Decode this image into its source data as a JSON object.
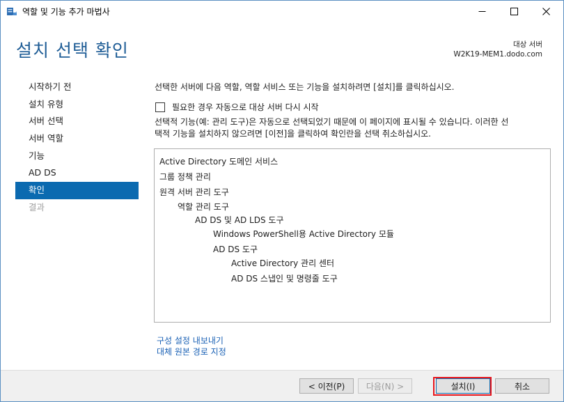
{
  "window": {
    "title": "역할 및 기능 추가 마법사",
    "minimize_glyph": "—",
    "maximize_glyph": "☐",
    "close_glyph": "✕"
  },
  "header": {
    "page_title": "설치 선택 확인",
    "dest_label": "대상 서버",
    "dest_server": "W2K19-MEM1.dodo.com"
  },
  "nav": {
    "items": [
      {
        "label": "시작하기 전",
        "state": "normal"
      },
      {
        "label": "설치 유형",
        "state": "normal"
      },
      {
        "label": "서버 선택",
        "state": "normal"
      },
      {
        "label": "서버 역할",
        "state": "normal"
      },
      {
        "label": "기능",
        "state": "normal"
      },
      {
        "label": "AD DS",
        "state": "normal"
      },
      {
        "label": "확인",
        "state": "active"
      },
      {
        "label": "결과",
        "state": "disabled"
      }
    ]
  },
  "content": {
    "intro": "선택한 서버에 다음 역할, 역할 서비스 또는 기능을 설치하려면 [설치]를 클릭하십시오.",
    "restart_checkbox_label": "필요한 경우 자동으로 대상 서버 다시 시작",
    "restart_checked": false,
    "note_line1": "선택적 기능(예: 관리 도구)은 자동으로 선택되었기 때문에 이 페이지에 표시될 수 있습니다. 이러한 선",
    "note_line2": "택적 기능을 설치하지 않으려면 [이전]을 클릭하여 확인란을 선택 취소하십시오.",
    "features": [
      {
        "label": "Active Directory 도메인 서비스",
        "level": 0
      },
      {
        "label": "그룹 정책 관리",
        "level": 0
      },
      {
        "label": "원격 서버 관리 도구",
        "level": 0
      },
      {
        "label": "역할 관리 도구",
        "level": 1
      },
      {
        "label": "AD DS 및 AD LDS 도구",
        "level": 2
      },
      {
        "label": "Windows PowerShell용 Active Directory 모듈",
        "level": 3
      },
      {
        "label": "AD DS 도구",
        "level": 3
      },
      {
        "label": "Active Directory 관리 센터",
        "level": 4
      },
      {
        "label": "AD DS 스냅인 및 명령줄 도구",
        "level": 4
      }
    ],
    "export_link": "구성 설정 내보내기",
    "alt_source_link": "대체 원본 경로 지정"
  },
  "footer": {
    "prev_label": "< 이전(P)",
    "next_label": "다음(N) >",
    "install_label": "설치(I)",
    "cancel_label": "취소"
  },
  "colors": {
    "accent": "#0b6ab0",
    "title": "#1f5d96",
    "link": "#1a61b5",
    "highlight": "#e8151b"
  }
}
